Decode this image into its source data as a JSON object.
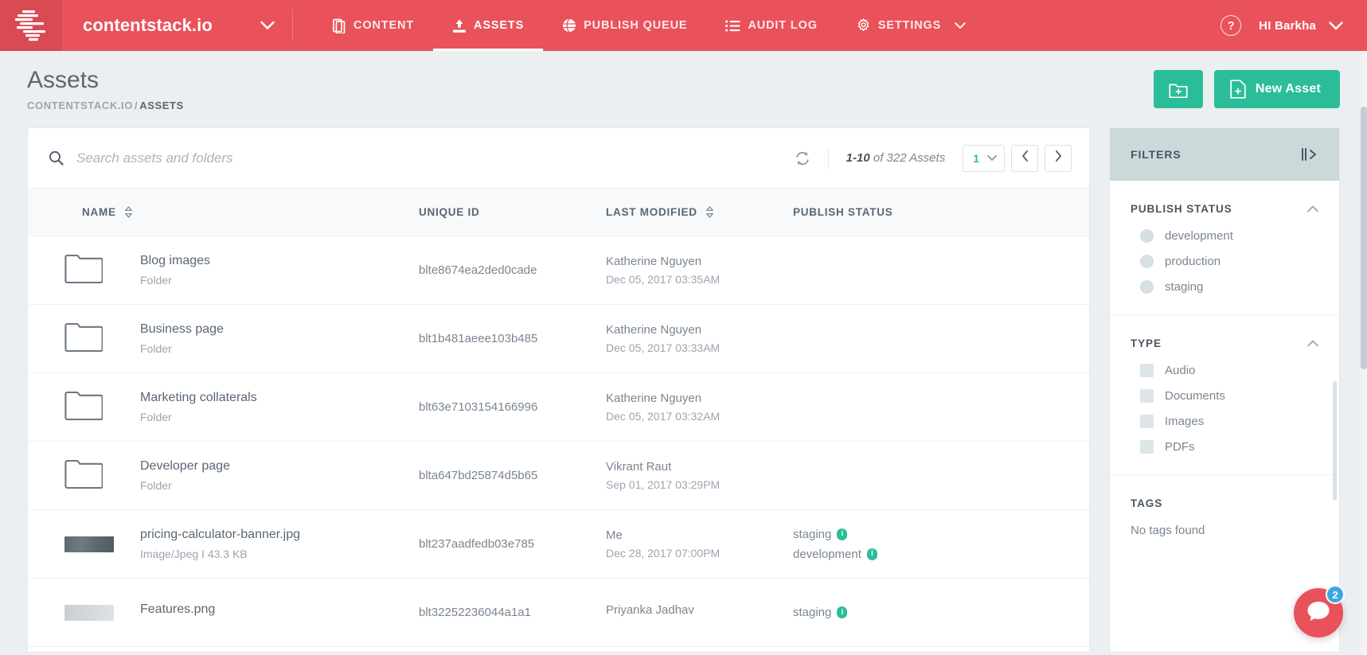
{
  "topnav": {
    "logo_icon": "contentstack-logo-icon",
    "org_name": "contentstack.io",
    "org_caret_icon": "chevron-down-icon",
    "items": [
      {
        "label": "CONTENT",
        "icon": "content-stack-icon",
        "active": false
      },
      {
        "label": "ASSETS",
        "icon": "upload-icon",
        "active": true
      },
      {
        "label": "PUBLISH QUEUE",
        "icon": "globe-icon",
        "active": false
      },
      {
        "label": "AUDIT LOG",
        "icon": "list-icon",
        "active": false
      },
      {
        "label": "SETTINGS",
        "icon": "gear-icon",
        "active": false
      }
    ],
    "settings_caret_icon": "chevron-down-icon",
    "help_label": "?",
    "help_icon": "help-circle-icon",
    "user_greeting": "HI Barkha",
    "user_caret_icon": "chevron-down-icon",
    "brand_color": "#e9525a"
  },
  "header": {
    "title": "Assets",
    "breadcrumb_root": "CONTENTSTACK.IO",
    "breadcrumb_sep": "/",
    "breadcrumb_current": "ASSETS",
    "new_folder_icon": "folder-plus-icon",
    "new_asset_icon": "file-plus-icon",
    "new_asset_label": "New Asset",
    "accent_color": "#2bbd9a"
  },
  "toolbar": {
    "search_icon": "search-icon",
    "search_placeholder": "Search assets and folders",
    "search_value": "",
    "refresh_icon": "refresh-icon",
    "range": "1-10",
    "count_suffix": "of 322 Assets",
    "page_number": "1",
    "page_caret_icon": "chevron-down-icon",
    "prev_icon": "chevron-left-icon",
    "next_icon": "chevron-right-icon"
  },
  "table": {
    "columns": [
      {
        "label": "NAME",
        "sortable": true,
        "sort_icon": "sort-icon"
      },
      {
        "label": "UNIQUE ID",
        "sortable": false
      },
      {
        "label": "LAST MODIFIED",
        "sortable": true,
        "sort_icon": "sort-icon"
      },
      {
        "label": "PUBLISH STATUS",
        "sortable": false
      }
    ],
    "rows": [
      {
        "kind": "folder",
        "icon": "folder-icon",
        "name": "Blog images",
        "meta": "Folder",
        "unique_id": "blte8674ea2ded0cade",
        "modified_by": "Katherine Nguyen",
        "modified_at": "Dec 05, 2017 03:35AM",
        "statuses": []
      },
      {
        "kind": "folder",
        "icon": "folder-icon",
        "name": "Business page",
        "meta": "Folder",
        "unique_id": "blt1b481aeee103b485",
        "modified_by": "Katherine Nguyen",
        "modified_at": "Dec 05, 2017 03:33AM",
        "statuses": []
      },
      {
        "kind": "folder",
        "icon": "folder-icon",
        "name": "Marketing collaterals",
        "meta": "Folder",
        "unique_id": "blt63e7103154166996",
        "modified_by": "Katherine Nguyen",
        "modified_at": "Dec 05, 2017 03:32AM",
        "statuses": []
      },
      {
        "kind": "folder",
        "icon": "folder-icon",
        "name": "Developer page",
        "meta": "Folder",
        "unique_id": "blta647bd25874d5b65",
        "modified_by": "Vikrant Raut",
        "modified_at": "Sep 01, 2017 03:29PM",
        "statuses": []
      },
      {
        "kind": "image",
        "icon": "image-thumbnail",
        "name": "pricing-calculator-banner.jpg",
        "meta": "Image/Jpeg  I 43.3 KB",
        "unique_id": "blt237aadfedb03e785",
        "modified_by": "Me",
        "modified_at": "Dec 28, 2017 07:00PM",
        "statuses": [
          "staging",
          "development"
        ]
      },
      {
        "kind": "image",
        "icon": "image-thumbnail",
        "name": "Features.png",
        "meta": "",
        "unique_id": "blt32252236044a1a1",
        "modified_by": "Priyanka Jadhav",
        "modified_at": "",
        "statuses": [
          "staging"
        ]
      }
    ]
  },
  "filters": {
    "title": "FILTERS",
    "collapse_icon": "collapse-panel-icon",
    "groups": [
      {
        "title": "PUBLISH STATUS",
        "chevron_icon": "chevron-up-icon",
        "control": "round",
        "items": [
          "development",
          "production",
          "staging"
        ]
      },
      {
        "title": "TYPE",
        "chevron_icon": "chevron-up-icon",
        "control": "square",
        "items": [
          "Audio",
          "Documents",
          "Images",
          "PDFs"
        ]
      }
    ],
    "tags_title": "TAGS",
    "tags_empty": "No tags found"
  },
  "intercom": {
    "icon": "chat-bubble-icon",
    "badge": "2",
    "badge_color": "#3ba9e0"
  }
}
